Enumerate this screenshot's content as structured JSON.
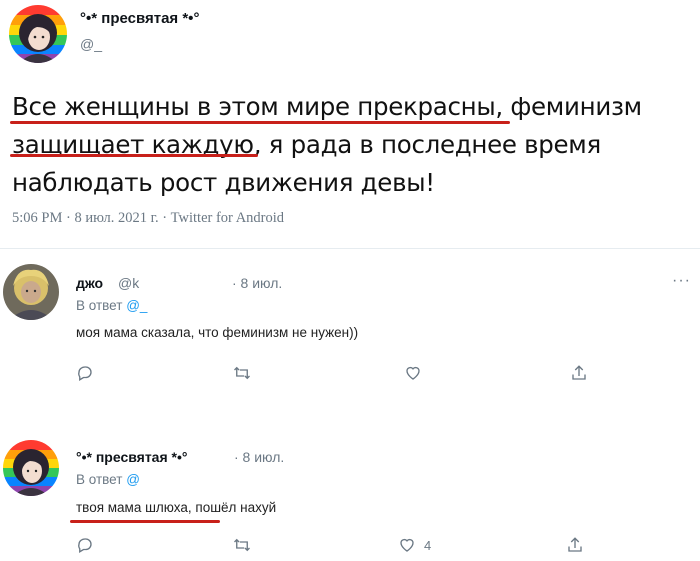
{
  "main_tweet": {
    "display_name": "°•* пресвятая *•°",
    "handle": "@_",
    "text_lines": [
      "Все женщины в этом мире прекрасны, феминизм",
      "защищает каждую, я рада в последнее время",
      "наблюдать рост движения девы!"
    ],
    "meta": "5:06 PM · 8 июл. 2021 г. · Twitter for Android"
  },
  "replies": [
    {
      "display_name": "джо",
      "handle": "@k",
      "date": "· 8 июл.",
      "reply_to_prefix": "В ответ",
      "reply_to_handle": "@_",
      "text": "моя мама сказала, что феминизм не нужен))",
      "more": "···",
      "likes": ""
    },
    {
      "display_name": "°•* пресвятая *•°",
      "date": "· 8 июл.",
      "reply_to_prefix": "В ответ",
      "reply_to_handle": "@",
      "text": "твоя мама шлюха, пошёл нахуй",
      "likes": "4"
    }
  ],
  "colors": {
    "underline": "#c8201a",
    "link": "#1d9bf0",
    "muted": "#6b7884"
  },
  "icons": [
    "reply-icon",
    "retweet-icon",
    "like-icon",
    "share-icon",
    "more-icon"
  ]
}
